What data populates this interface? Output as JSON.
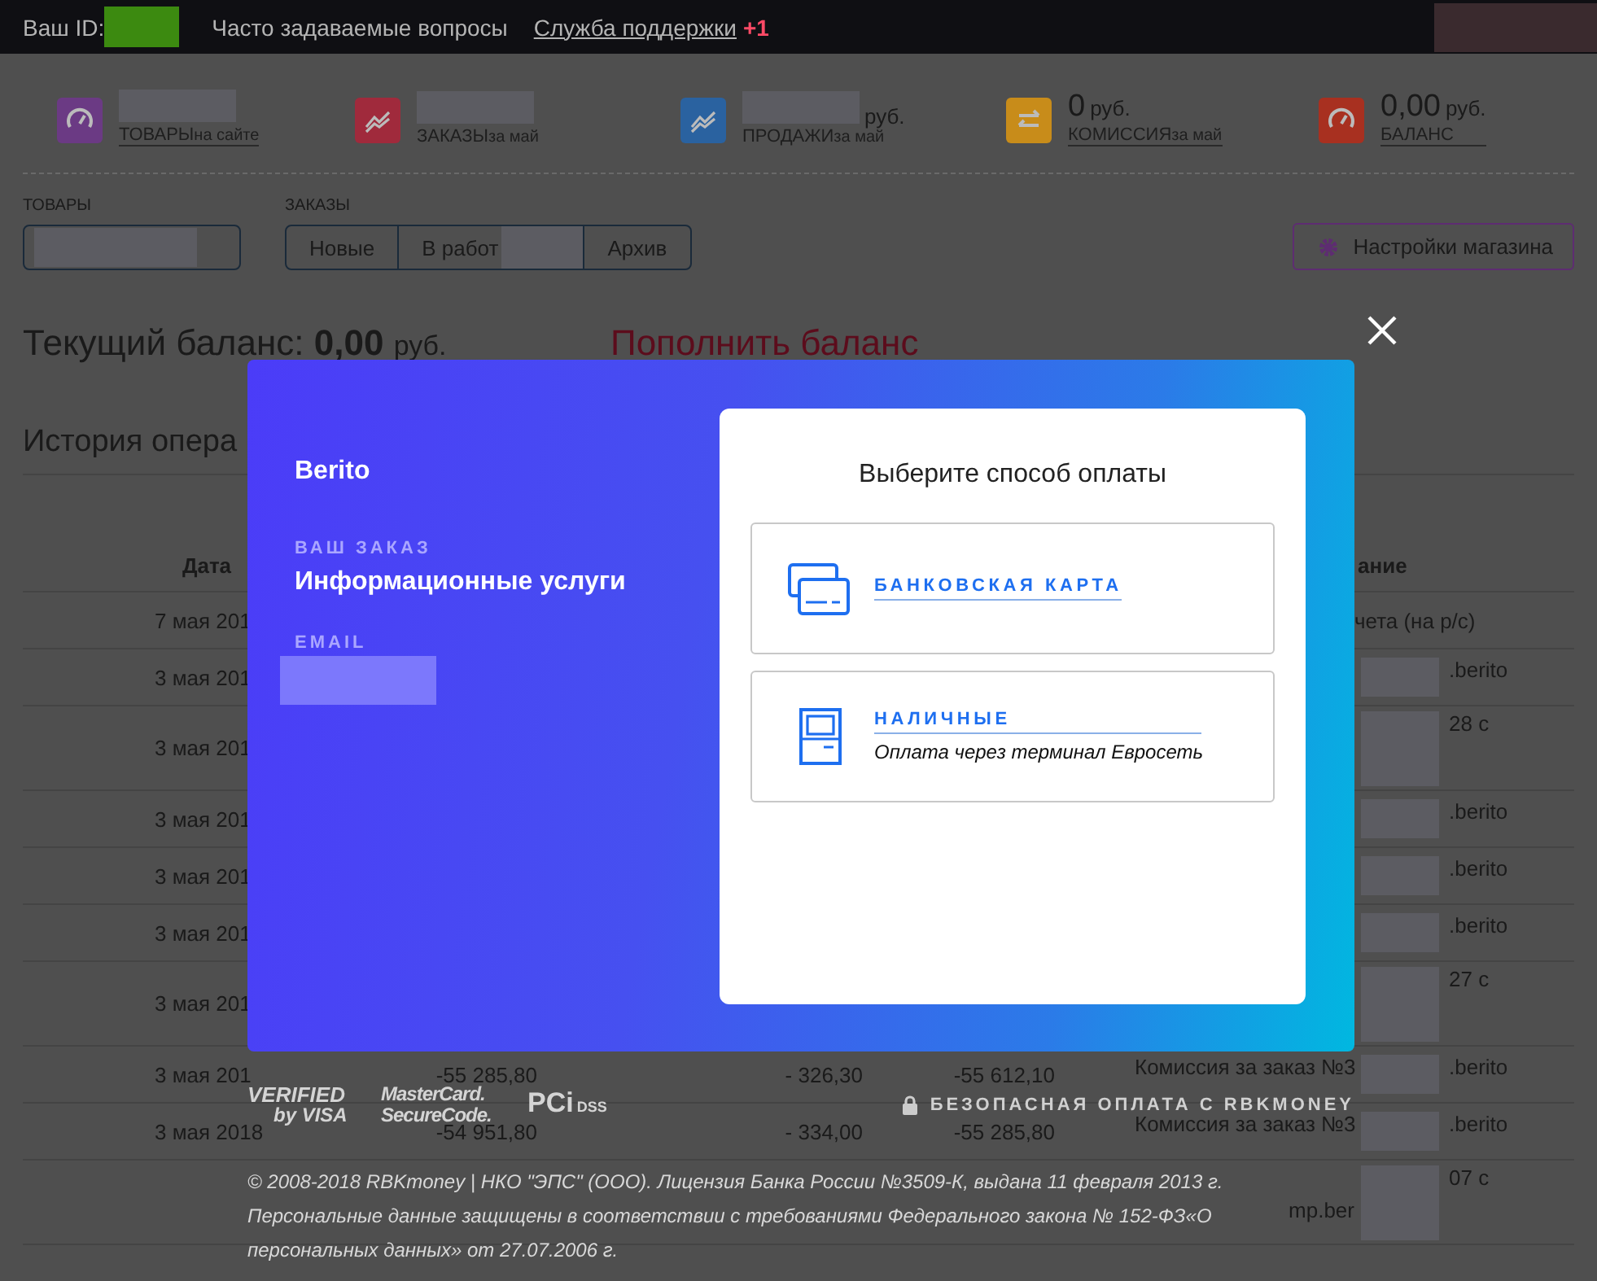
{
  "top_bar": {
    "id_label": "Ваш ID:",
    "faq_link": "Часто задаваемые вопросы",
    "support_link": "Служба поддержки",
    "support_badge": "+1"
  },
  "stats": [
    {
      "kind": "gauge",
      "color": "#6b3a84",
      "label": "ТОВАРЫ",
      "sublabel": "на сайте",
      "linked": true
    },
    {
      "kind": "trend",
      "color": "#a02a3c",
      "label": "ЗАКАЗЫ",
      "sublabel": "за май",
      "linked": false
    },
    {
      "kind": "trend",
      "color": "#2a62a0",
      "unit": "руб.",
      "label": "ПРОДАЖИ",
      "sublabel": "за май",
      "linked": false
    },
    {
      "kind": "arrows",
      "color": "#c88c1a",
      "value": "0",
      "unit": "руб.",
      "label": "КОМИССИЯ",
      "sublabel": "за май",
      "linked": true
    },
    {
      "kind": "gauge",
      "color": "#a83020",
      "value": "0,00",
      "unit": "руб.",
      "label": "БАЛАНС",
      "linked": true
    }
  ],
  "filters": {
    "products_label": "ТОВАРЫ",
    "orders_label": "ЗАКАЗЫ",
    "order_tabs": [
      {
        "kind": "plain",
        "label": "Новые"
      },
      {
        "kind": "masked",
        "label": "В работ"
      },
      {
        "kind": "plain",
        "label": "Архив"
      }
    ],
    "settings_button": "Настройки магазина"
  },
  "balance": {
    "label": "Текущий баланс:",
    "amount": "0,00",
    "unit": "руб.",
    "topup_link": "Пополнить баланс"
  },
  "history": {
    "title": "История опера",
    "header": {
      "date": "Дата",
      "description": "ание"
    },
    "rows": [
      {
        "kind": "plain",
        "date": "7 мая 201",
        "tail": "чета (на р/с)"
      },
      {
        "kind": "masked",
        "date": "3 мая 201",
        "tail": ".berito"
      },
      {
        "kind": "masked_tall",
        "date": "3 мая 201",
        "tail": "28 с"
      },
      {
        "kind": "masked",
        "date": "3 мая 201",
        "tail": ".berito"
      },
      {
        "kind": "masked",
        "date": "3 мая 201",
        "tail": ".berito"
      },
      {
        "kind": "masked",
        "date": "3 мая 201",
        "tail": ".berito"
      },
      {
        "kind": "masked_tall",
        "date": "3 мая 201",
        "tail": "27 с"
      },
      {
        "kind": "masked",
        "date": "3 мая 201",
        "amount": "-55 285,80",
        "change": "- 326,30",
        "total": "-55 612,10",
        "description": "Комиссия за заказ №3",
        "tail": ".berito"
      },
      {
        "kind": "masked",
        "date": "3 мая 2018",
        "amount": "-54 951,80",
        "change": "- 334,00",
        "total": "-55 285,80",
        "description": "Комиссия за заказ №3",
        "tail": ".berito"
      },
      {
        "kind": "masked_tall",
        "description_line2": "mp.ber",
        "tail": "07 с"
      }
    ]
  },
  "modal": {
    "merchant": "Berito",
    "order_label": "ВАШ ЗАКАЗ",
    "order": "Информационные услуги",
    "email_label": "EMAIL",
    "title": "Выберите способ оплаты",
    "methods": [
      {
        "kind": "card",
        "label": "БАНКОВСКАЯ КАРТА"
      },
      {
        "kind": "cash",
        "label": "НАЛИЧНЫЕ",
        "note": "Оплата через терминал Евросеть"
      }
    ]
  },
  "footer": {
    "logos": [
      {
        "kind": "visa",
        "lines": [
          "VERIFIED",
          "by VISA"
        ]
      },
      {
        "kind": "mastercard",
        "lines": [
          "MasterCard.",
          "SecureCode."
        ]
      },
      {
        "kind": "pci",
        "lines": [
          "PCi",
          "DSS"
        ]
      }
    ],
    "secure": "БЕЗОПАСНАЯ ОПЛАТА С RBKMONEY",
    "legal": [
      "© 2008-2018 RBKmoney | НКО \"ЭПС\" (ООО). Лицензия Банка России №3509-К, выдана 11 февраля 2013 г.",
      "Персональные данные защищены в соответствии с требованиями Федерального закона № 152-ФЗ«О",
      "персональных данных» от 27.07.2006 г."
    ]
  }
}
